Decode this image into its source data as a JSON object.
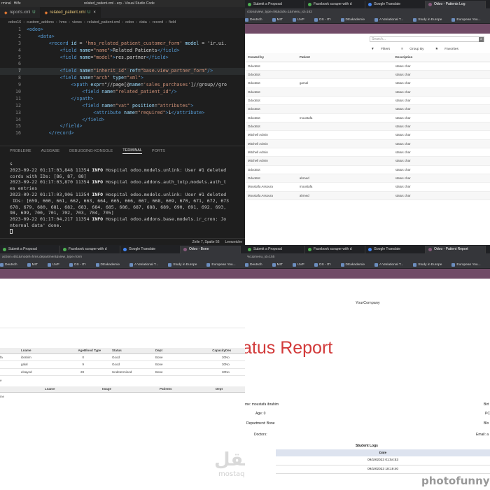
{
  "vscode": {
    "menu": [
      "rminal",
      "Hilfe"
    ],
    "window_title": "related_patient.xml - erp - Visual Studio Code",
    "tabs": [
      {
        "label": "reports.xml",
        "badge": "U",
        "active": false
      },
      {
        "label": "related_patient.xml",
        "badge": "U",
        "active": true
      }
    ],
    "breadcrumb": [
      "odoo16",
      "custom_addons",
      "hms",
      "views",
      "related_patient.xml",
      "odoo",
      "data",
      "record",
      "field"
    ],
    "code_lines": [
      {
        "n": "1",
        "text": "<odoo>"
      },
      {
        "n": "2",
        "text": "    <data>"
      },
      {
        "n": "3",
        "text": "        <record id = 'hms_related_patient_customer_form' model = 'ir.ui."
      },
      {
        "n": "4",
        "text": "            <field name=\"name\">Related Patients</field>"
      },
      {
        "n": "5",
        "text": "            <field name=\"model\">res.partner</field>"
      },
      {
        "n": "6",
        "text": ""
      },
      {
        "n": "7",
        "text": "            <field name=\"inherit_id\" ref=\"base.view_partner_form\"/>"
      },
      {
        "n": "8",
        "text": "            <field name=\"arch\" type=\"xml\">"
      },
      {
        "n": "9",
        "text": "                <xpath expr=\"//page[@name='sales_purchases']//group//gro"
      },
      {
        "n": "10",
        "text": "                    <field name=\"related_patient_id\"/>"
      },
      {
        "n": "11",
        "text": "                </xpath>"
      },
      {
        "n": "12",
        "text": "                    <field name=\"vat\" position=\"attributes\">"
      },
      {
        "n": "13",
        "text": "                        <attribute name=\"required\">1</attribute>"
      },
      {
        "n": "14",
        "text": "                    </field>"
      },
      {
        "n": "15",
        "text": "            </field>"
      },
      {
        "n": "16",
        "text": "        </record>"
      }
    ],
    "panel_tabs": [
      "PROBLEME",
      "AUSGABE",
      "DEBUGGING-KONSOLE",
      "TERMINAL",
      "PORTS"
    ],
    "active_panel": "TERMINAL",
    "terminal_lines": [
      {
        "pre": "s",
        "info": "",
        "post": ""
      },
      {
        "pre": "2023-09-22 01:17:03,848 11354 ",
        "info": "INFO",
        "post": " Hospital odoo.models.unlink: User #1 deleted"
      },
      {
        "pre": "cords with IDs: [86, 87, 88]",
        "info": "",
        "post": ""
      },
      {
        "pre": "2023-09-22 01:17:03,870 11354 ",
        "info": "INFO",
        "post": " Hospital odoo.addons.auth_totp.models.auth_t"
      },
      {
        "pre": "es entries",
        "info": "",
        "post": ""
      },
      {
        "pre": "2023-09-22 01:17:03,906 11354 ",
        "info": "INFO",
        "post": " Hospital odoo.models.unlink: User #1 deleted"
      },
      {
        "pre": " IDs: [659, 660, 661, 662, 663, 664, 665, 666, 667, 668, 669, 670, 671, 672, 673",
        "info": "",
        "post": ""
      },
      {
        "pre": "678, 679, 680, 681, 682, 683, 684, 685, 686, 687, 688, 689, 690, 691, 692, 693,",
        "info": "",
        "post": ""
      },
      {
        "pre": "98, 699, 700, 701, 702, 703, 704, 705]",
        "info": "",
        "post": ""
      },
      {
        "pre": "2023-09-22 01:17:04,217 11354 ",
        "info": "INFO",
        "post": " Hospital odoo.addons.base.models.ir_cron: Jo"
      },
      {
        "pre": "nternal data' done.",
        "info": "",
        "post": ""
      }
    ],
    "status": {
      "position": "Zeile 7, Spalte 56",
      "indent": "Leerzeiche"
    }
  },
  "browser_tabs": [
    {
      "label": "Submit a Proposal",
      "active": false
    },
    {
      "label": "Facebook scraper with d",
      "active": false
    },
    {
      "label": "Google Translate",
      "active": false
    },
    {
      "label": "Odoo - Patients Log",
      "active": true
    }
  ],
  "browser_tabs_bl": [
    {
      "label": "Submit a Proposal",
      "active": false
    },
    {
      "label": "Facebook scraper with d",
      "active": false
    },
    {
      "label": "Google Translate",
      "active": false
    },
    {
      "label": "Odoo - Bone",
      "active": true
    }
  ],
  "browser_tabs_br": [
    {
      "label": "Submit a Proposal",
      "active": false
    },
    {
      "label": "Facebook scraper with d",
      "active": false
    },
    {
      "label": "Google Translate",
      "active": false
    },
    {
      "label": "Odoo - Patient Report",
      "active": true
    }
  ],
  "bookmarks": [
    "Deutsch",
    "MIT",
    "UVP",
    "OS - ITI",
    "DEakademie",
    "A Variational T...",
    "Study in Europe",
    "European You...",
    "Nach"
  ],
  "bookmarks_bl": [
    "Deutsch",
    "MIT",
    "UVP",
    "OS - ITI",
    "DEakademie",
    "A Variational T...",
    "Study in Europe",
    "European You...",
    "Nach"
  ],
  "bookmarks_br": [
    "Deutsch",
    "MIT",
    "UVP",
    "OS - ITI",
    "DEakademie",
    "A Variational T...",
    "Study in Europe",
    "European You...",
    "Nach"
  ],
  "urls": {
    "tr": "ction&view_type=list&cids=1&menu_id=162",
    "bl": "action=461&model=hms.department&view_type=form",
    "br": "%1&menu_id=155"
  },
  "odoo_log": {
    "search_placeholder": "Search...",
    "filters": [
      "Filters",
      "Group By",
      "Favorites"
    ],
    "columns": [
      "Created by",
      "Patient",
      "Description"
    ],
    "rows": [
      {
        "by": "OdooBot",
        "patient": "",
        "desc": "status char"
      },
      {
        "by": "OdooBot",
        "patient": "",
        "desc": "status char"
      },
      {
        "by": "OdooBot",
        "patient": "gamal",
        "desc": "status char"
      },
      {
        "by": "OdooBot",
        "patient": "",
        "desc": "status char"
      },
      {
        "by": "OdooBot",
        "patient": "",
        "desc": "status char"
      },
      {
        "by": "OdooBot",
        "patient": "",
        "desc": "status char"
      },
      {
        "by": "OdooBot",
        "patient": "moustafa",
        "desc": "status char"
      },
      {
        "by": "OdooBot",
        "patient": "",
        "desc": "status char"
      },
      {
        "by": "Mitchell Admin",
        "patient": "",
        "desc": "status char"
      },
      {
        "by": "Mitchell Admin",
        "patient": "",
        "desc": "status char"
      },
      {
        "by": "Mitchell Admin",
        "patient": "",
        "desc": "status char"
      },
      {
        "by": "Mitchell Admin",
        "patient": "",
        "desc": "status char"
      },
      {
        "by": "OdooBot",
        "patient": "",
        "desc": "status char"
      },
      {
        "by": "OdooBot",
        "patient": "ahmed",
        "desc": "status char"
      },
      {
        "by": "Moustafa Assoura",
        "patient": "moustafa",
        "desc": "status char"
      },
      {
        "by": "Moustafa Assoura",
        "patient": "ahmed",
        "desc": "status char"
      }
    ]
  },
  "department": {
    "columns": [
      "",
      "Lname",
      "Age",
      "Blood Type",
      "Status",
      "Dept",
      "Capacity",
      "Des"
    ],
    "rows": [
      {
        "first": "fa",
        "lname": "ibrahim",
        "age": "0",
        "blood": "",
        "status": "Good",
        "dept": "Bone",
        "cap": "30",
        "des": "No"
      },
      {
        "first": "",
        "lname": "galal",
        "age": "9",
        "blood": "",
        "status": "Good",
        "dept": "Bone",
        "cap": "30",
        "des": "No"
      },
      {
        "first": "",
        "lname": "elsayed",
        "age": "28",
        "blood": "",
        "status": "Undetermined",
        "dept": "Bone",
        "cap": "30",
        "des": "No"
      }
    ],
    "add_line": "e",
    "columns2": [
      "Lname",
      "Image",
      "Patients",
      "Dept"
    ],
    "add_line2": "ine"
  },
  "report": {
    "company": "YourCompany",
    "title": "atus Report",
    "name": "me: moustafa ibrahim",
    "age": "Age: 0",
    "department": "Department: Bone",
    "doctors": "Doctors:",
    "right_birth": "Birt",
    "right_pc": "PC",
    "right_blo": "Blo",
    "right_email": "Email: a",
    "logs_title": "Student Logs",
    "logs_header": "Date",
    "logs": [
      "09/19/2023 01:54:53",
      "09/19/2023 18:19:40"
    ]
  },
  "watermarks": {
    "mostaql_ar": "مستقل",
    "mostaql": "mostaql.com",
    "photofunny": "photofunny"
  }
}
